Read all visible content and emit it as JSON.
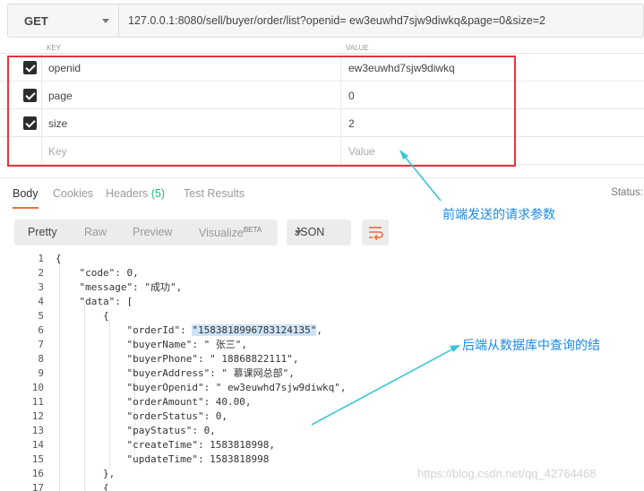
{
  "request": {
    "method": "GET",
    "url": "127.0.0.1:8080/sell/buyer/order/list?openid= ew3euwhd7sjw9diwkq&page=0&size=2"
  },
  "params": {
    "header_key": "KEY",
    "header_value": "VALUE",
    "rows": [
      {
        "key": "openid",
        "value": "ew3euwhd7sjw9diwkq",
        "checked": true
      },
      {
        "key": "page",
        "value": "0",
        "checked": true
      },
      {
        "key": "size",
        "value": "2",
        "checked": true
      }
    ],
    "placeholder_key": "Key",
    "placeholder_value": "Value"
  },
  "response_tabs": {
    "body": "Body",
    "cookies": "Cookies",
    "headers": "Headers",
    "headers_count": "(5)",
    "test_results": "Test Results",
    "status": "Status:"
  },
  "view": {
    "pretty": "Pretty",
    "raw": "Raw",
    "preview": "Preview",
    "visualize": "Visualize",
    "beta": "BETA",
    "format": "JSON"
  },
  "code_lines": [
    {
      "n": "1",
      "t": "{"
    },
    {
      "n": "2",
      "t": "    \"code\": 0,"
    },
    {
      "n": "3",
      "t": "    \"message\": \"成功\","
    },
    {
      "n": "4",
      "t": "    \"data\": ["
    },
    {
      "n": "5",
      "t": "        {"
    },
    {
      "n": "6",
      "t": "            \"orderId\": \"1583818996783124135\","
    },
    {
      "n": "7",
      "t": "            \"buyerName\": \" 张三\","
    },
    {
      "n": "8",
      "t": "            \"buyerPhone\": \" 18868822111\","
    },
    {
      "n": "9",
      "t": "            \"buyerAddress\": \" 慕课网总部\","
    },
    {
      "n": "10",
      "t": "            \"buyerOpenid\": \" ew3euwhd7sjw9diwkq\","
    },
    {
      "n": "11",
      "t": "            \"orderAmount\": 40.00,"
    },
    {
      "n": "12",
      "t": "            \"orderStatus\": 0,"
    },
    {
      "n": "13",
      "t": "            \"payStatus\": 0,"
    },
    {
      "n": "14",
      "t": "            \"createTime\": 1583818998,"
    },
    {
      "n": "15",
      "t": "            \"updateTime\": 1583818998"
    },
    {
      "n": "16",
      "t": "        },"
    },
    {
      "n": "17",
      "t": "        {"
    }
  ],
  "annotations": {
    "request_note": "前端发送的请求参数",
    "response_note": "后端从数据库中查询的结"
  },
  "watermark": "https://blog.csdn.net/qq_42764468",
  "colors": {
    "highlight_box": "#e8343c",
    "annotation": "#1e88e5",
    "active_tab_underline": "#f26b3a",
    "headers_count": "#26b47f",
    "wrap_icon": "#f26b3a"
  }
}
